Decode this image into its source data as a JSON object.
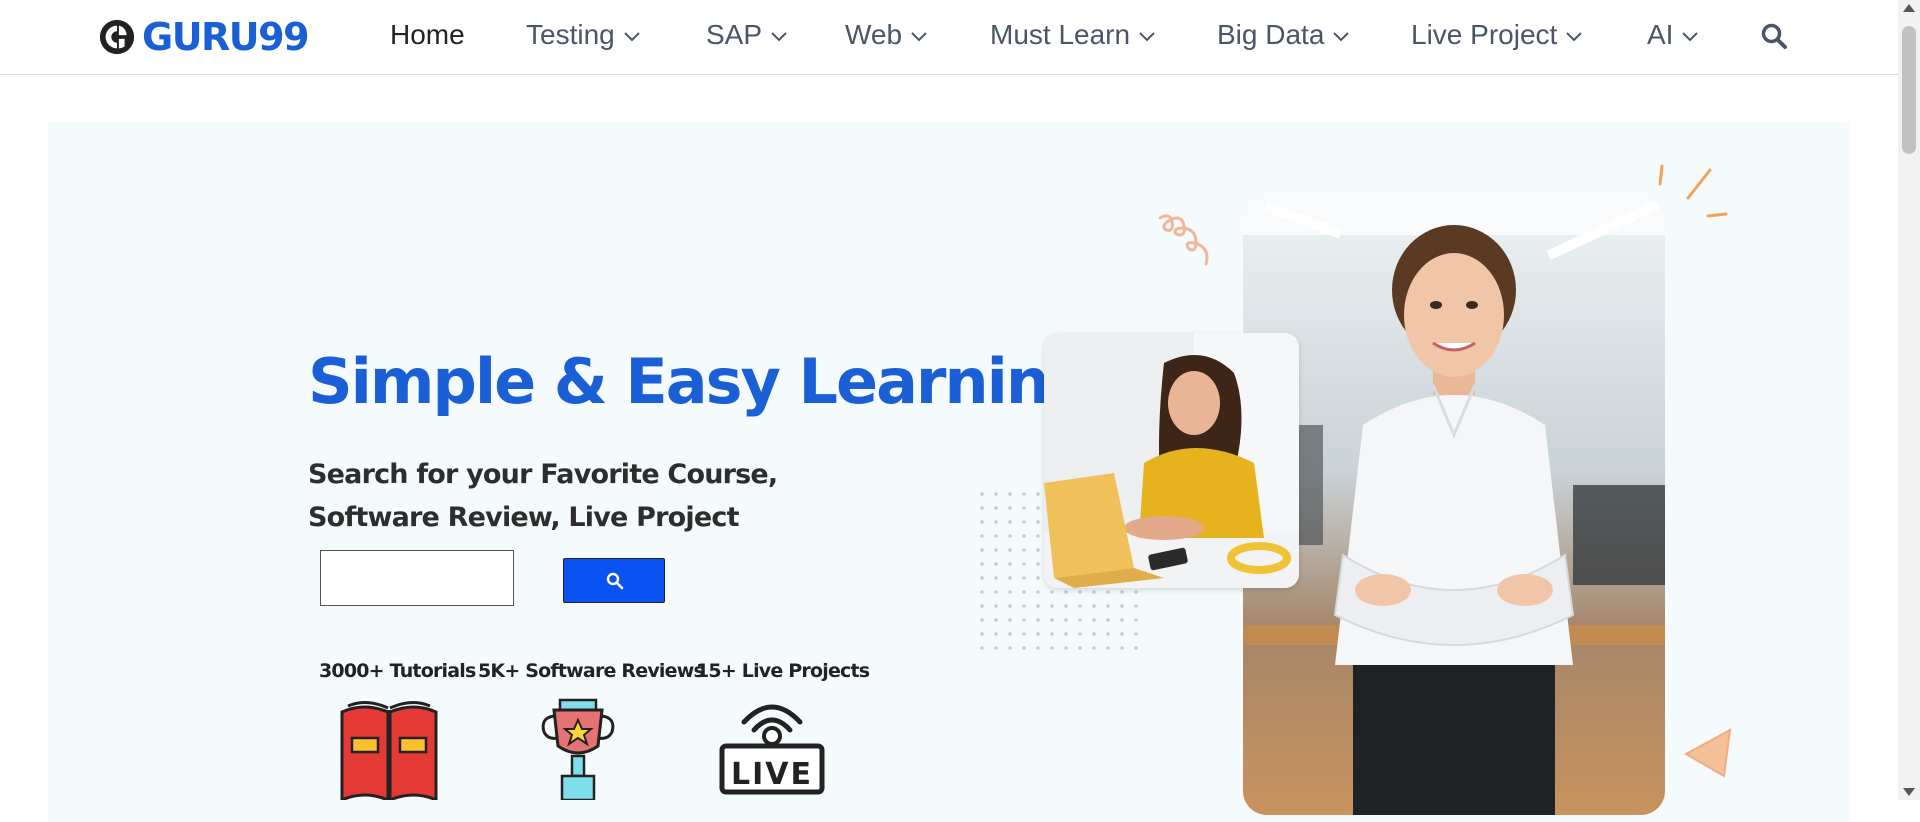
{
  "brand": {
    "name": "GURU99"
  },
  "nav": {
    "items": [
      {
        "label": "Home",
        "dropdown": false
      },
      {
        "label": "Testing",
        "dropdown": true
      },
      {
        "label": "SAP",
        "dropdown": true
      },
      {
        "label": "Web",
        "dropdown": true
      },
      {
        "label": "Must Learn",
        "dropdown": true
      },
      {
        "label": "Big Data",
        "dropdown": true
      },
      {
        "label": "Live Project",
        "dropdown": true
      },
      {
        "label": "AI",
        "dropdown": true
      }
    ],
    "search_icon": "magnifier-icon"
  },
  "hero": {
    "title": "Simple & Easy Learning",
    "subtitle": "Search for your Favorite Course, Software Review, Live Project",
    "search": {
      "value": "",
      "placeholder": ""
    },
    "stats": [
      {
        "label": "3000+ Tutorials",
        "icon": "book-icon"
      },
      {
        "label": "5K+ Software Reviews",
        "icon": "trophy-icon"
      },
      {
        "label": "15+ Live Projects",
        "icon": "live-broadcast-icon"
      }
    ],
    "live_badge_text": "LIVE"
  },
  "colors": {
    "brand_blue": "#1a5fd6",
    "search_button": "#0a53f2",
    "hero_background": "#f5fbfd",
    "nav_text": "#4a5568"
  }
}
